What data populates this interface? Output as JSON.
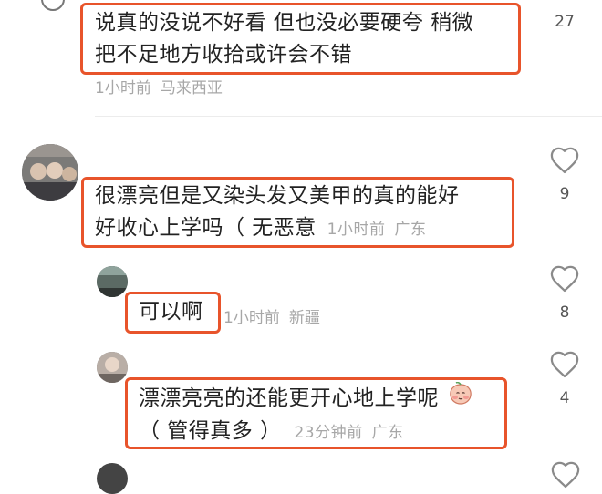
{
  "comments": [
    {
      "text_lines": [
        "说真的没说不好看 但也没必要硬夸 稍微",
        "把不足地方收拾或许会不错"
      ],
      "time": "1小时前",
      "location": "马来西亚",
      "likes": "27"
    },
    {
      "text_lines": [
        "很漂亮但是又染头发又美甲的真的能好",
        "好收心上学吗（ 无恶意"
      ],
      "time": "1小时前",
      "location": "广东",
      "likes": "9"
    },
    {
      "text_lines": [
        "可以啊"
      ],
      "time": "1小时前",
      "location": "新疆",
      "likes": "8"
    },
    {
      "text_lines": [
        "漂漂亮亮的还能更开心地上学呢",
        "（ 管得真多 ）"
      ],
      "time": "23分钟前",
      "location": "广东",
      "likes": "4"
    }
  ],
  "colors": {
    "highlight_border": "#e8542b",
    "meta_text": "#a7a7a7",
    "heart_stroke": "#8a8a8a"
  },
  "icons": {
    "like": "heart-outline-icon",
    "emoji": "peach-face-emoji-icon"
  }
}
